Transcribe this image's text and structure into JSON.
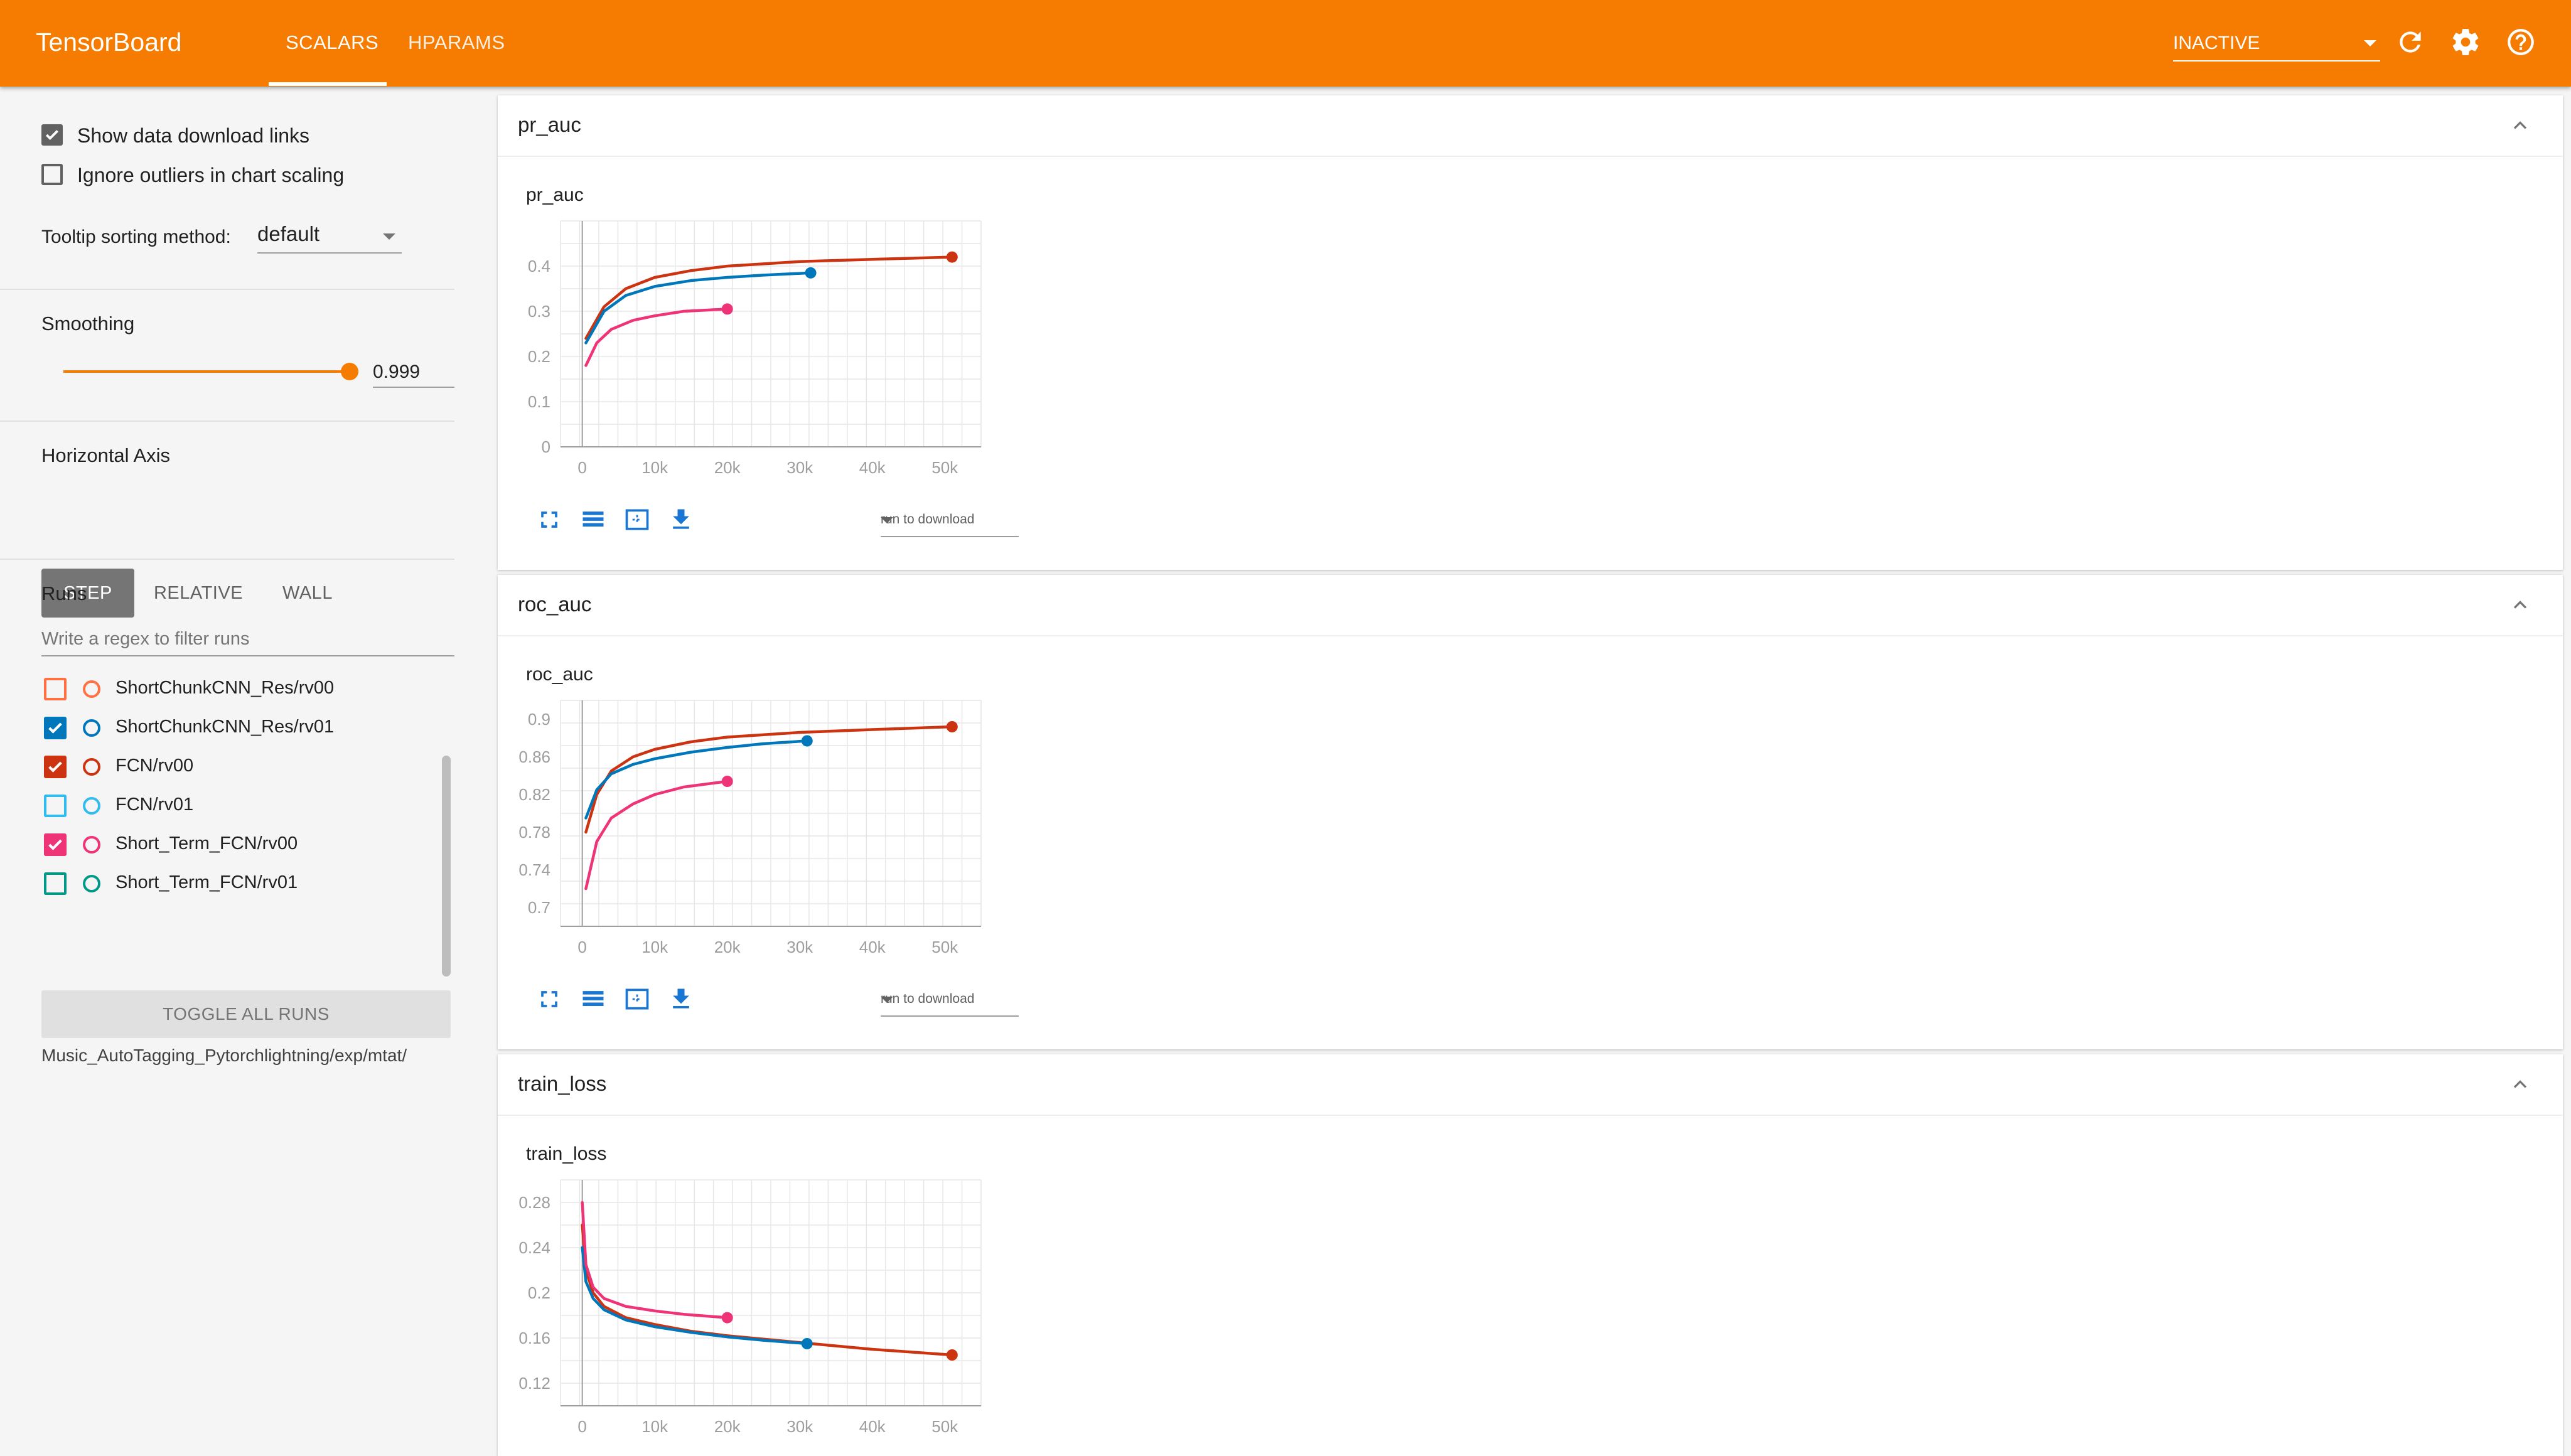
{
  "toolbar": {
    "brand": "TensorBoard",
    "tabs": [
      {
        "label": "SCALARS"
      },
      {
        "label": "HPARAMS"
      }
    ],
    "status_select": "INACTIVE"
  },
  "sidebar": {
    "show_download_links": "Show data download links",
    "ignore_outliers": "Ignore outliers in chart scaling",
    "tooltip_label": "Tooltip sorting method:",
    "tooltip_value": "default",
    "smoothing_label": "Smoothing",
    "smoothing_value": "0.999",
    "horizontal_axis_label": "Horizontal Axis",
    "axis_options": [
      "STEP",
      "RELATIVE",
      "WALL"
    ],
    "runs_label": "Runs",
    "filter_placeholder": "Write a regex to filter runs",
    "runs": [
      {
        "name": "ShortChunkCNN_Res/rv00",
        "checked": false,
        "color": "#ff7043"
      },
      {
        "name": "ShortChunkCNN_Res/rv01",
        "checked": true,
        "color": "#0077bb"
      },
      {
        "name": "FCN/rv00",
        "checked": true,
        "color": "#cc3311"
      },
      {
        "name": "FCN/rv01",
        "checked": false,
        "color": "#33bbee"
      },
      {
        "name": "Short_Term_FCN/rv00",
        "checked": true,
        "color": "#ee3377"
      },
      {
        "name": "Short_Term_FCN/rv01",
        "checked": false,
        "color": "#009988"
      }
    ],
    "toggle_all": "TOGGLE ALL RUNS",
    "log_dir": "Music_AutoTagging_Pytorchlightning/exp/mtat/"
  },
  "run_to_download": "run to download",
  "chart_data": [
    {
      "type": "line",
      "title": "pr_auc",
      "xlim": [
        -3000,
        55000
      ],
      "ylim": [
        0,
        0.5
      ],
      "xticks": [
        0,
        10000,
        20000,
        30000,
        40000,
        50000
      ],
      "xtick_labels": [
        "0",
        "10k",
        "20k",
        "30k",
        "40k",
        "50k"
      ],
      "yticks": [
        0,
        0.1,
        0.2,
        0.3,
        0.4
      ],
      "ytick_labels": [
        "0",
        "0.1",
        "0.2",
        "0.3",
        "0.4"
      ],
      "series": [
        {
          "color": "#cc3311",
          "x": [
            500,
            3000,
            6000,
            10000,
            15000,
            20000,
            30000,
            40000,
            51000
          ],
          "y": [
            0.24,
            0.31,
            0.35,
            0.375,
            0.39,
            0.4,
            0.41,
            0.415,
            0.42
          ]
        },
        {
          "color": "#0077bb",
          "x": [
            500,
            3000,
            6000,
            10000,
            15000,
            20000,
            25000,
            31500
          ],
          "y": [
            0.23,
            0.3,
            0.335,
            0.355,
            0.368,
            0.375,
            0.38,
            0.385
          ]
        },
        {
          "color": "#ee3377",
          "x": [
            500,
            2000,
            4000,
            7000,
            10000,
            14000,
            20000
          ],
          "y": [
            0.18,
            0.23,
            0.26,
            0.28,
            0.29,
            0.3,
            0.305
          ]
        }
      ]
    },
    {
      "type": "line",
      "title": "roc_auc",
      "xlim": [
        -3000,
        55000
      ],
      "ylim": [
        0.68,
        0.92
      ],
      "xticks": [
        0,
        10000,
        20000,
        30000,
        40000,
        50000
      ],
      "xtick_labels": [
        "0",
        "10k",
        "20k",
        "30k",
        "40k",
        "50k"
      ],
      "yticks": [
        0.7,
        0.74,
        0.78,
        0.82,
        0.86,
        0.9
      ],
      "ytick_labels": [
        "0.7",
        "0.74",
        "0.78",
        "0.82",
        "0.86",
        "0.9"
      ],
      "series": [
        {
          "color": "#cc3311",
          "x": [
            500,
            2000,
            4000,
            7000,
            10000,
            15000,
            20000,
            30000,
            40000,
            51000
          ],
          "y": [
            0.78,
            0.82,
            0.845,
            0.86,
            0.868,
            0.876,
            0.881,
            0.886,
            0.889,
            0.892
          ]
        },
        {
          "color": "#0077bb",
          "x": [
            500,
            2000,
            4000,
            7000,
            10000,
            15000,
            20000,
            25000,
            31000
          ],
          "y": [
            0.795,
            0.825,
            0.842,
            0.852,
            0.858,
            0.865,
            0.87,
            0.874,
            0.877
          ]
        },
        {
          "color": "#ee3377",
          "x": [
            500,
            2000,
            4000,
            7000,
            10000,
            14000,
            20000
          ],
          "y": [
            0.72,
            0.77,
            0.795,
            0.81,
            0.82,
            0.828,
            0.834
          ]
        }
      ]
    },
    {
      "type": "line",
      "title": "train_loss",
      "xlim": [
        -3000,
        55000
      ],
      "ylim": [
        0.1,
        0.3
      ],
      "xticks": [
        0,
        10000,
        20000,
        30000,
        40000,
        50000
      ],
      "xtick_labels": [
        "0",
        "10k",
        "20k",
        "30k",
        "40k",
        "50k"
      ],
      "yticks": [
        0.12,
        0.16,
        0.2,
        0.24,
        0.28
      ],
      "ytick_labels": [
        "0.12",
        "0.16",
        "0.2",
        "0.24",
        "0.28"
      ],
      "series": [
        {
          "color": "#cc3311",
          "x": [
            0,
            500,
            1500,
            3000,
            6000,
            10000,
            15000,
            20000,
            30000,
            40000,
            51000
          ],
          "y": [
            0.26,
            0.22,
            0.2,
            0.188,
            0.178,
            0.172,
            0.166,
            0.162,
            0.156,
            0.15,
            0.145
          ]
        },
        {
          "color": "#0077bb",
          "x": [
            0,
            500,
            1500,
            3000,
            6000,
            10000,
            15000,
            20000,
            25000,
            31000
          ],
          "y": [
            0.24,
            0.21,
            0.195,
            0.185,
            0.176,
            0.17,
            0.165,
            0.161,
            0.158,
            0.155
          ]
        },
        {
          "color": "#ee3377",
          "x": [
            0,
            500,
            1500,
            3000,
            6000,
            10000,
            14000,
            20000
          ],
          "y": [
            0.28,
            0.225,
            0.205,
            0.195,
            0.188,
            0.184,
            0.181,
            0.178
          ]
        }
      ]
    }
  ]
}
